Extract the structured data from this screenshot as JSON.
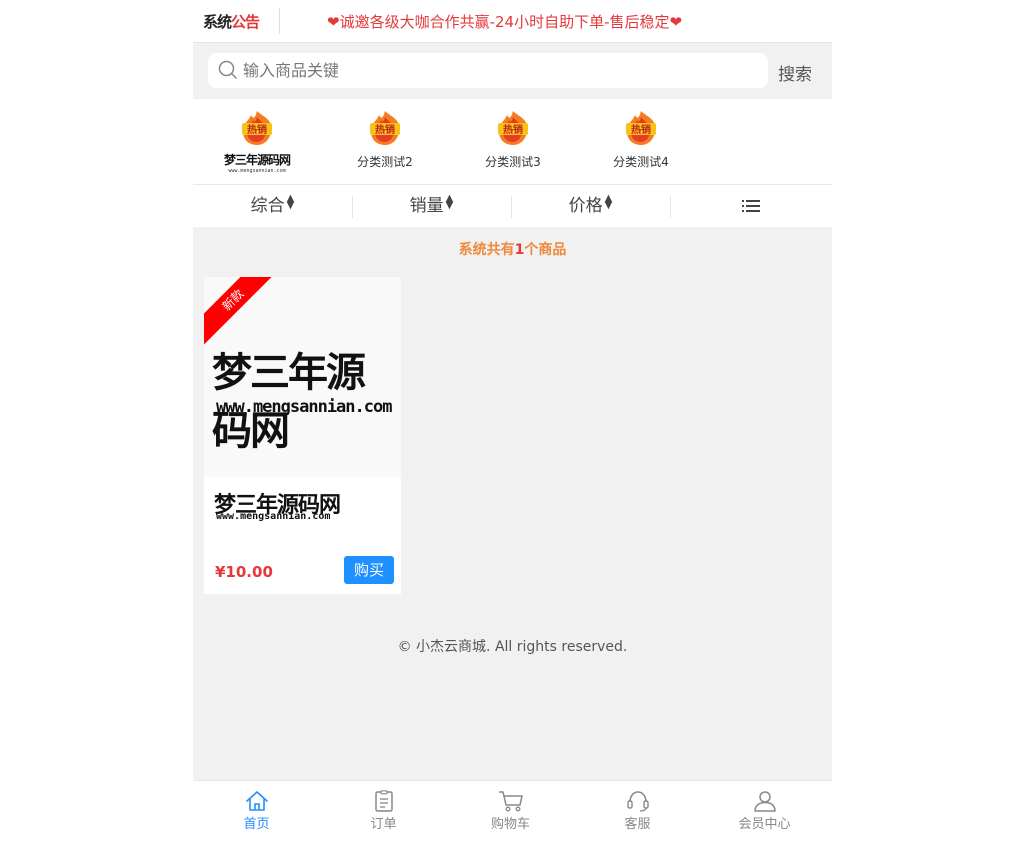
{
  "notice": {
    "logo_prefix": "系统",
    "logo_suffix": "公告",
    "text": "诚邀各级大咖合作共赢-24小时自助下单-售后稳定"
  },
  "search": {
    "placeholder": "输入商品关键",
    "button": "搜索"
  },
  "categories": [
    {
      "icon": "hot-sale-icon",
      "badge": "热销",
      "label": "梦三年源码网",
      "sublabel": "www.mengsannian.com"
    },
    {
      "icon": "hot-sale-icon",
      "badge": "热销",
      "label": "分类测试2"
    },
    {
      "icon": "hot-sale-icon",
      "badge": "热销",
      "label": "分类测试3"
    },
    {
      "icon": "hot-sale-icon",
      "badge": "热销",
      "label": "分类测试4"
    }
  ],
  "sort": {
    "items": [
      "综合",
      "销量",
      "价格"
    ],
    "list_icon": "list-icon"
  },
  "count": {
    "prefix": "系统共有",
    "number": "1",
    "suffix": "个商品"
  },
  "products": [
    {
      "ribbon": "新款",
      "image_title": "梦三年源码网",
      "image_url": "www.mengsannian.com",
      "title": "梦三年源码网",
      "title_url": "www.mengsannian.com",
      "price": "¥10.00",
      "buy_label": "购买"
    }
  ],
  "footer": "© 小杰云商城. All rights reserved.",
  "tabbar": [
    {
      "label": "首页",
      "icon": "home-icon",
      "active": true
    },
    {
      "label": "订单",
      "icon": "order-icon",
      "active": false
    },
    {
      "label": "购物车",
      "icon": "cart-icon",
      "active": false
    },
    {
      "label": "客服",
      "icon": "headset-icon",
      "active": false
    },
    {
      "label": "会员中心",
      "icon": "user-icon",
      "active": false
    }
  ],
  "colors": {
    "accent": "#1e90ff",
    "price": "#e4393c",
    "notice": "#e4393c",
    "count": "#f0883c",
    "ribbon": "#ff0000"
  }
}
